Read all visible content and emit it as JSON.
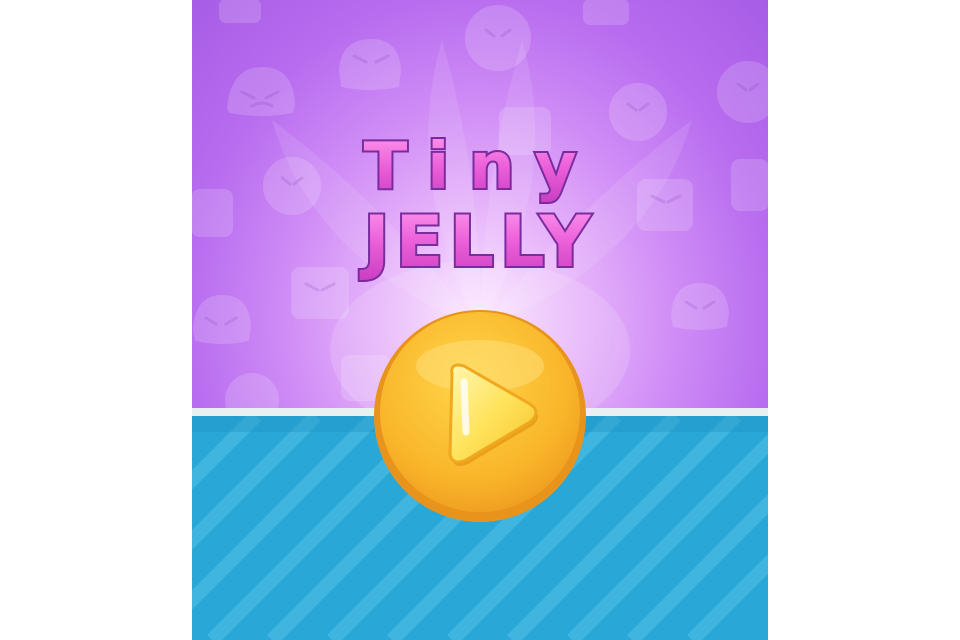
{
  "game": {
    "title_line1": "Tiny",
    "title_line2": "JELLY",
    "play_label": "play"
  },
  "colors": {
    "sky_top": "#a75ce6",
    "sky_glow": "#fbe6ff",
    "water": "#29a8d8",
    "water_stripe": "#4fbfe6",
    "title_pink": "#e85ad6",
    "title_outline": "#7a2c9e",
    "button_orange": "#f7b52a",
    "button_gold": "#ffd84a"
  },
  "icons": {
    "background": "angry-jelly-icon",
    "play": "play-icon"
  }
}
